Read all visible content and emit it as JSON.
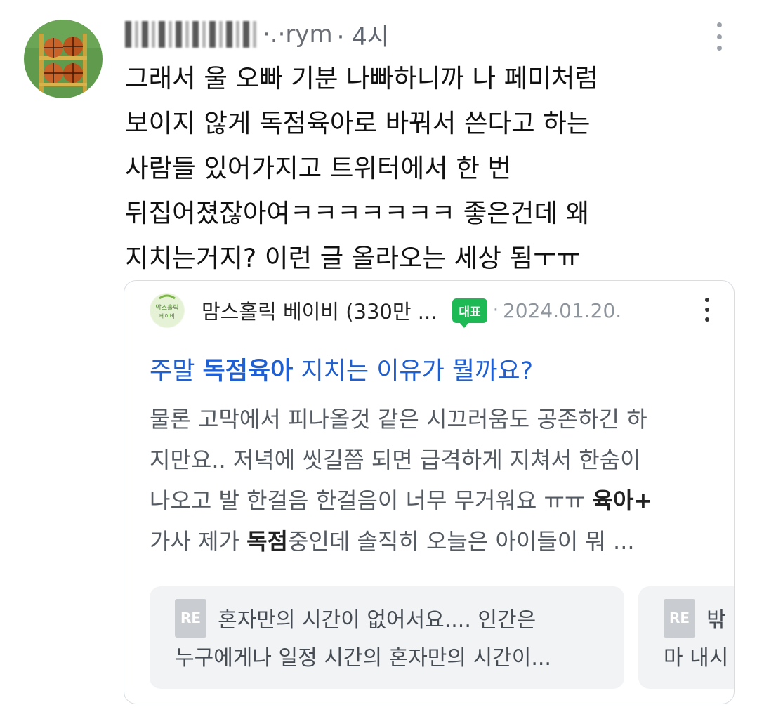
{
  "comment": {
    "author_visible": "·.·rym",
    "time": "· 4시",
    "lines": [
      "그래서 울 오빠 기분 나빠하니까 나 페미처럼",
      "보이지 않게 독점육아로 바꿔서 쓴다고 하는",
      "사람들 있어가지고 트위터에서 한 번",
      "뒤집어졌잖아여ㅋㅋㅋㅋㅋㅋㅋ 좋은건데 왜",
      "지치는거지? 이런 글 올라오는 세상 됨ㅜㅠ"
    ]
  },
  "card": {
    "cafe_logo_text": "맘스홀릭 베이비",
    "cafe_name": "맘스홀릭 베이비 (330만 ...",
    "rep_badge": "대표",
    "sep": "·",
    "date": "2024.01.20.",
    "title": {
      "pre": "주말 ",
      "bold": "독점육아",
      "post": " 지치는 이유가 뭘까요?"
    },
    "excerpt": {
      "line1": "물론 고막에서 피나올것 같은 시끄러움도 공존하긴 하",
      "line2": "지만요.. 저녁에 씻길쯤 되면 급격하게 지쳐서 한숨이",
      "line3_pre": "나오고 발 한걸음 한걸음이 너무 무거워요 ㅠㅠ ",
      "line3_bold": "육아+",
      "line4_pre": "가사 제가 ",
      "line4_bold": "독점",
      "line4_post": "중인데 솔직히 오늘은 아이들이 뭐 ..."
    },
    "replies": [
      {
        "badge": "RE",
        "line1": "혼자만의 시간이 없어서요.... 인간은",
        "line2": "누구에게나 일정 시간의 혼자만의 시간이..."
      },
      {
        "badge": "RE",
        "line1": "밖",
        "line2": "마 내시"
      }
    ]
  },
  "colors": {
    "link_blue": "#1f5fd0",
    "badge_green": "#1db954",
    "reply_bg": "#f2f3f5"
  }
}
